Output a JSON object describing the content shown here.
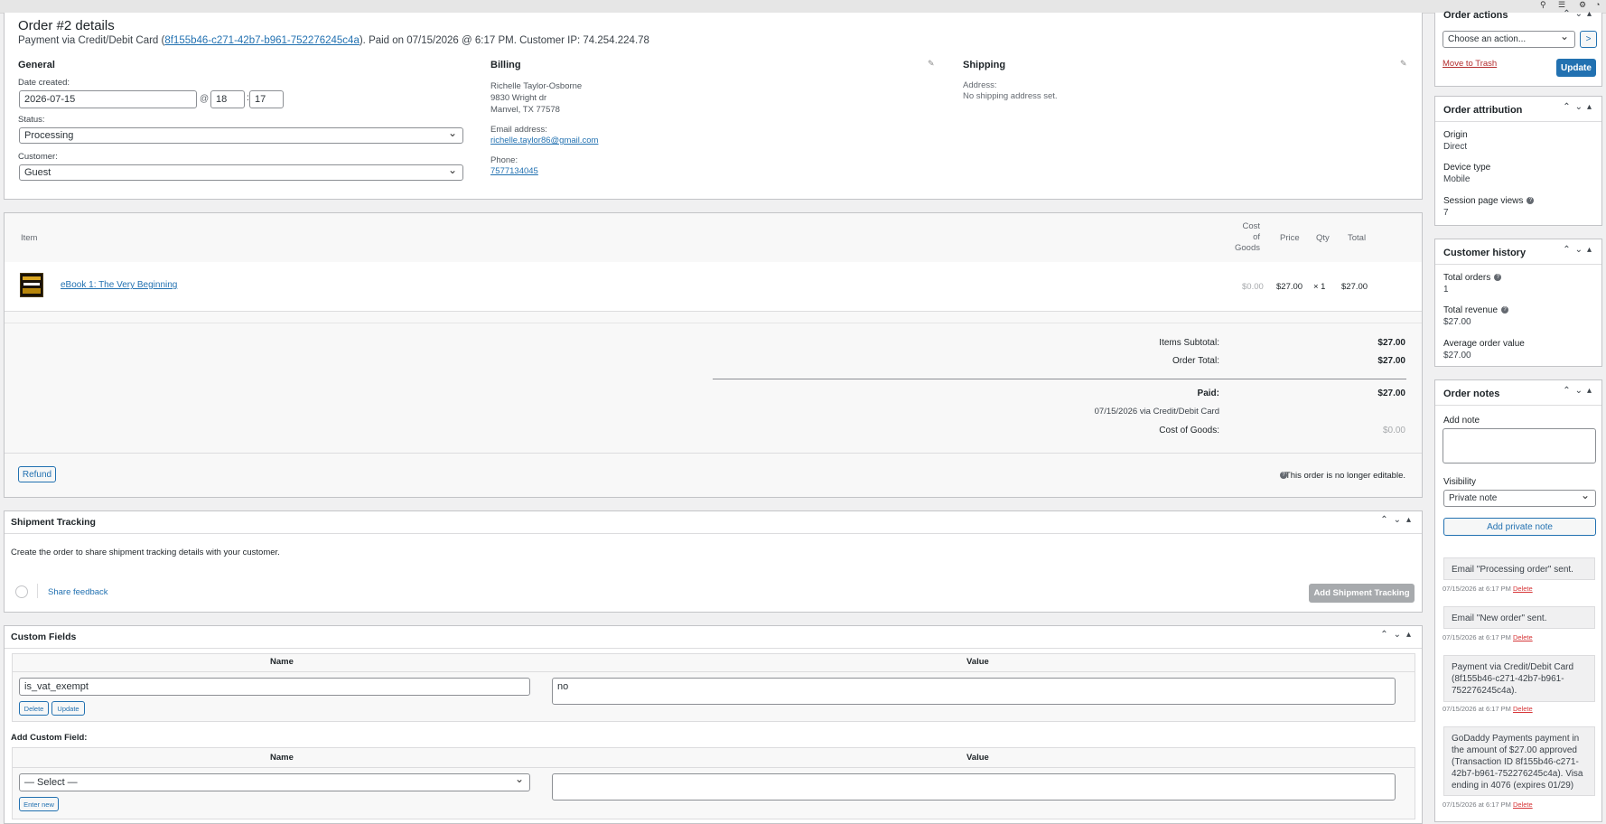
{
  "order": {
    "title": "Order #2 details",
    "payment_prefix": "Payment via Credit/Debit Card (",
    "transaction_id": "8f155b46-c271-42b7-b961-752276245c4a",
    "payment_suffix": "). Paid on 07/15/2026 @ 6:17 PM. Customer IP: 74.254.224.78"
  },
  "general": {
    "heading": "General",
    "date_label": "Date created:",
    "date_value": "2026-07-15",
    "at": "@",
    "hour": "18",
    "colon": ":",
    "minute": "17",
    "status_label": "Status:",
    "status_value": "Processing",
    "customer_label": "Customer:",
    "customer_value": "Guest"
  },
  "billing": {
    "heading": "Billing",
    "name": "Richelle Taylor-Osborne",
    "street": "9830 Wright dr",
    "city": "Manvel, TX 77578",
    "email_label": "Email address:",
    "email": "richelle.taylor86@gmail.com",
    "phone_label": "Phone:",
    "phone": "7577134045"
  },
  "shipping": {
    "heading": "Shipping",
    "address_label": "Address:",
    "address_value": "No shipping address set."
  },
  "items": {
    "headers": {
      "item": "Item",
      "cost1": "Cost",
      "cost2": "of",
      "cost3": "Goods",
      "price": "Price",
      "qty": "Qty",
      "total": "Total"
    },
    "rows": [
      {
        "name": "eBook 1: The Very Beginning",
        "cost": "$0.00",
        "price": "$27.00",
        "qty": "× 1",
        "total": "$27.00"
      }
    ]
  },
  "totals": {
    "subtotal_label": "Items Subtotal:",
    "subtotal": "$27.00",
    "order_total_label": "Order Total:",
    "order_total": "$27.00",
    "paid_label": "Paid:",
    "paid": "$27.00",
    "paid_via": "07/15/2026 via Credit/Debit Card",
    "cog_label": "Cost of Goods:",
    "cog": "$0.00",
    "refund_label": "Refund",
    "not_editable": "This order is no longer editable."
  },
  "shipment": {
    "title": "Shipment Tracking",
    "text": "Create the order to share shipment tracking details with your customer.",
    "feedback": "Share feedback",
    "add_button": "Add Shipment Tracking"
  },
  "custom_fields": {
    "title": "Custom Fields",
    "name_header": "Name",
    "value_header": "Value",
    "field_name": "is_vat_exempt",
    "field_value": "no",
    "delete_label": "Delete",
    "update_label": "Update",
    "add_label": "Add Custom Field:",
    "select_placeholder": "— Select —",
    "enter_new": "Enter new"
  },
  "sidebar": {
    "actions": {
      "title": "Order actions",
      "select": "Choose an action...",
      "go": ">",
      "trash": "Move to Trash",
      "update": "Update"
    },
    "attribution": {
      "title": "Order attribution",
      "origin_label": "Origin",
      "origin": "Direct",
      "device_label": "Device type",
      "device": "Mobile",
      "views_label": "Session page views",
      "views": "7"
    },
    "history": {
      "title": "Customer history",
      "orders_label": "Total orders",
      "orders": "1",
      "revenue_label": "Total revenue",
      "revenue": "$27.00",
      "aov_label": "Average order value",
      "aov": "$27.00"
    },
    "notes": {
      "title": "Order notes",
      "add_label": "Add note",
      "visibility_label": "Visibility",
      "visibility": "Private note",
      "add_button": "Add private note",
      "list": [
        {
          "text": "Email \"Processing order\" sent.",
          "meta": "07/15/2026 at 6:17 PM",
          "delete": "Delete"
        },
        {
          "text": "Email \"New order\" sent.",
          "meta": "07/15/2026 at 6:17 PM",
          "delete": "Delete"
        },
        {
          "text": "Payment via Credit/Debit Card (8f155b46-c271-42b7-b961-752276245c4a).",
          "meta": "07/15/2026 at 6:17 PM",
          "delete": "Delete"
        },
        {
          "text": "GoDaddy Payments payment in the amount of $27.00 approved (Transaction ID 8f155b46-c271-42b7-b961-752276245c4a). Visa ending in 4076 (expires 01/29)",
          "meta": "07/15/2026 at 6:17 PM",
          "delete": "Delete"
        }
      ]
    }
  },
  "icons": {
    "pencil": "pencil-icon",
    "help": "help-icon",
    "chevron": "chevron-icon"
  }
}
